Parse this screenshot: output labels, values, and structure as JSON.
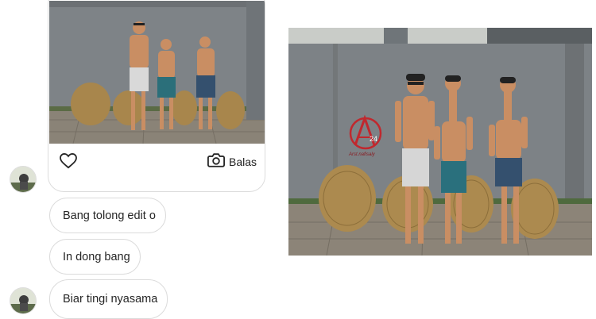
{
  "message_card": {
    "reply_label": "Balas",
    "like_icon": "heart-icon",
    "reply_icon": "camera-icon"
  },
  "messages": [
    {
      "text": "Bang tolong edit o"
    },
    {
      "text": "In dong bang"
    },
    {
      "text": "Biar tingi nyasama"
    }
  ],
  "edited_photo": {
    "watermark_text": "24",
    "watermark_caption": "Arst.nafisaly"
  },
  "colors": {
    "wall": "#7d8286",
    "skin": "#c98e63",
    "bubble_border": "#dbdbdb"
  }
}
